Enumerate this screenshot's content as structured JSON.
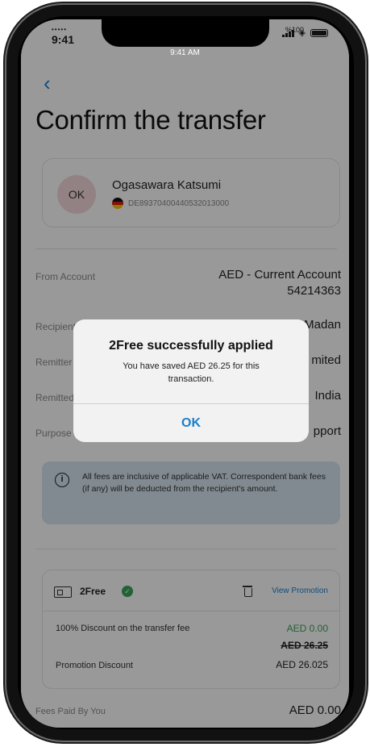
{
  "status_bar": {
    "carrier": "•••••",
    "time": "9:41",
    "notch_time": "9:41 AM",
    "battery_percent": "%100"
  },
  "header": {
    "back_icon": "chevron-left-icon",
    "title": "Confirm the transfer"
  },
  "recipient": {
    "initials": "OK",
    "name": "Ogasawara Katsumi",
    "iban": "DE89370400440532013000",
    "flag": "germany"
  },
  "details": [
    {
      "label": "From Account",
      "value": "AED - Current Account",
      "value2": "54214363"
    },
    {
      "label": "Recipient",
      "value": "Madan"
    },
    {
      "label": "Remitter",
      "value": "mited"
    },
    {
      "label": "Remitted to",
      "value": "India"
    },
    {
      "label": "Purpose",
      "value": "pport"
    }
  ],
  "info": {
    "icon": "info-icon",
    "text": "All fees are inclusive of applicable VAT. Correspondent bank fees (if any) will be deducted from the recipient's amount."
  },
  "promotion": {
    "name": "2Free",
    "view_label": "View Promotion",
    "discount_label": "100% Discount on the transfer fee",
    "discount_value": "AED 0.00",
    "original_fee": "AED 26.25",
    "promo_label": "Promotion Discount",
    "promo_value": "AED 26.025"
  },
  "fees": {
    "label": "Fees Paid By You",
    "value": "AED 0.00"
  },
  "alert": {
    "title": "2Free successfully applied",
    "message": "You have saved AED 26.25 for this transaction.",
    "button": "OK"
  },
  "colors": {
    "accent": "#1e7fc8",
    "success": "#3aa35a",
    "info_bg": "#d6e6f1",
    "avatar_bg": "#f6d9dc"
  }
}
